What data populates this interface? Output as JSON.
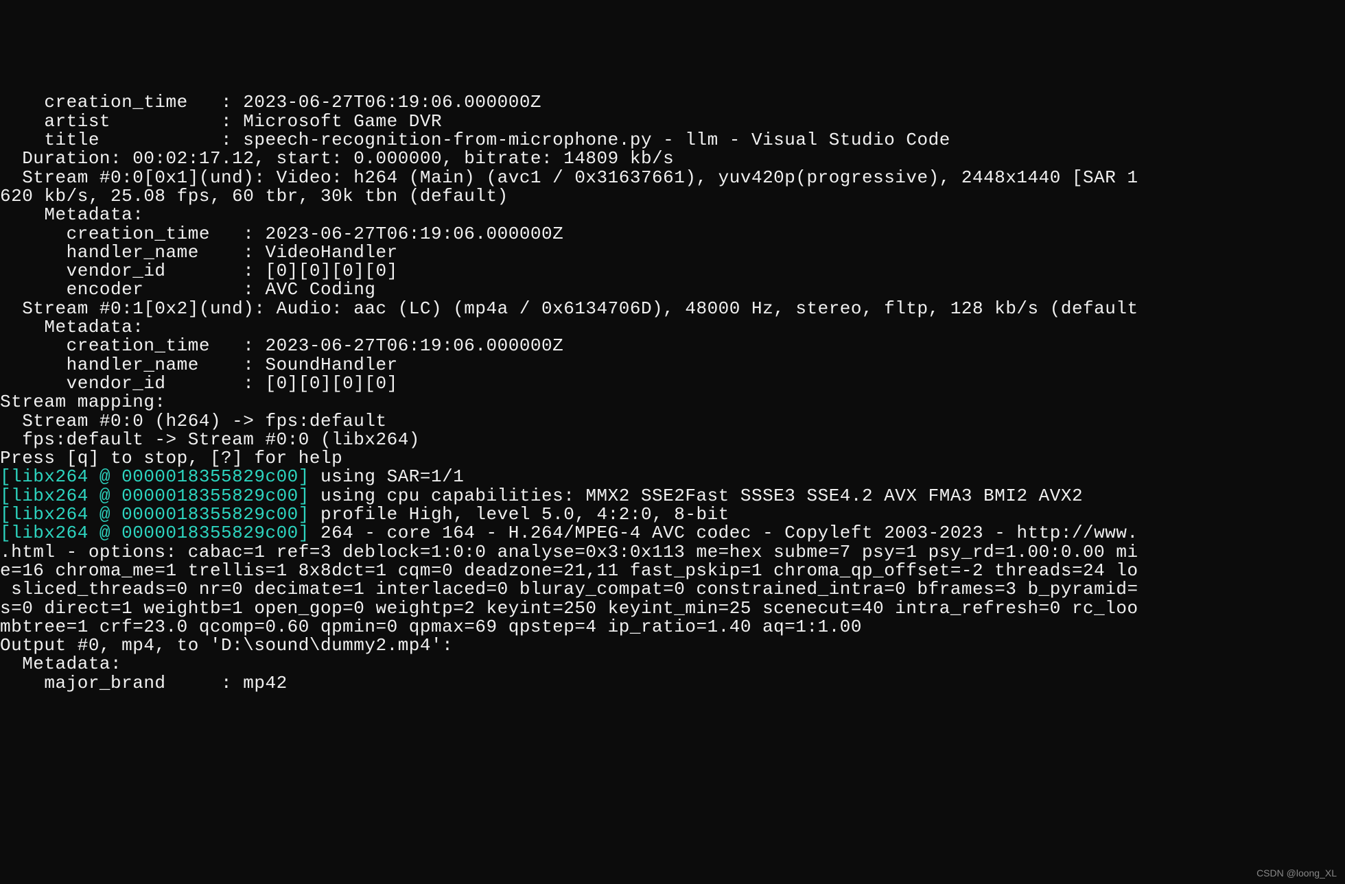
{
  "lines": [
    "    creation_time   : 2023-06-27T06:19:06.000000Z",
    "    artist          : Microsoft Game DVR",
    "    title           : speech-recognition-from-microphone.py - llm - Visual Studio Code",
    "  Duration: 00:02:17.12, start: 0.000000, bitrate: 14809 kb/s",
    "  Stream #0:0[0x1](und): Video: h264 (Main) (avc1 / 0x31637661), yuv420p(progressive), 2448x1440 [SAR 1",
    "620 kb/s, 25.08 fps, 60 tbr, 30k tbn (default)",
    "    Metadata:",
    "      creation_time   : 2023-06-27T06:19:06.000000Z",
    "      handler_name    : VideoHandler",
    "      vendor_id       : [0][0][0][0]",
    "      encoder         : AVC Coding",
    "  Stream #0:1[0x2](und): Audio: aac (LC) (mp4a / 0x6134706D), 48000 Hz, stereo, fltp, 128 kb/s (default",
    "    Metadata:",
    "      creation_time   : 2023-06-27T06:19:06.000000Z",
    "      handler_name    : SoundHandler",
    "      vendor_id       : [0][0][0][0]",
    "Stream mapping:",
    "  Stream #0:0 (h264) -> fps:default",
    "  fps:default -> Stream #0:0 (libx264)",
    "Press [q] to stop, [?] for help"
  ],
  "libx264": {
    "prefix": "[libx264 @ 0000018355829c00]",
    "msg1": " using SAR=1/1",
    "msg2": " using cpu capabilities: MMX2 SSE2Fast SSSE3 SSE4.2 AVX FMA3 BMI2 AVX2",
    "msg3": " profile High, level 5.0, 4:2:0, 8-bit",
    "msg4": " 264 - core 164 - H.264/MPEG-4 AVC codec - Copyleft 2003-2023 - http://www."
  },
  "options_lines": [
    ".html - options: cabac=1 ref=3 deblock=1:0:0 analyse=0x3:0x113 me=hex subme=7 psy=1 psy_rd=1.00:0.00 mi",
    "e=16 chroma_me=1 trellis=1 8x8dct=1 cqm=0 deadzone=21,11 fast_pskip=1 chroma_qp_offset=-2 threads=24 lo",
    " sliced_threads=0 nr=0 decimate=1 interlaced=0 bluray_compat=0 constrained_intra=0 bframes=3 b_pyramid=",
    "s=0 direct=1 weightb=1 open_gop=0 weightp=2 keyint=250 keyint_min=25 scenecut=40 intra_refresh=0 rc_loo",
    "mbtree=1 crf=23.0 qcomp=0.60 qpmin=0 qpmax=69 qpstep=4 ip_ratio=1.40 aq=1:1.00",
    "Output #0, mp4, to 'D:\\sound\\dummy2.mp4':",
    "  Metadata:",
    "    major_brand     : mp42"
  ],
  "watermark": "CSDN @loong_XL"
}
